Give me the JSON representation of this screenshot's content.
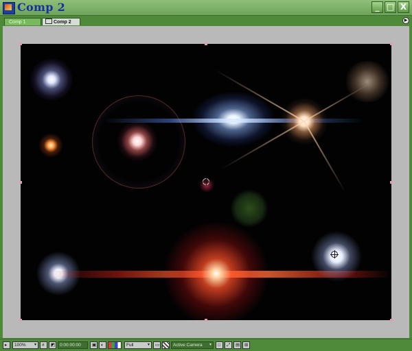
{
  "window": {
    "title": "Comp 2",
    "minimize_glyph": "_",
    "maximize_glyph": "□",
    "close_glyph": "X"
  },
  "tabs": [
    {
      "label": "Comp 1",
      "active": false
    },
    {
      "label": "Comp 2",
      "active": true
    }
  ],
  "panel_menu_glyph": "▶",
  "toolbar": {
    "zoom": "100%",
    "timecode": "0:00:00:00",
    "resolution": "Full",
    "camera": "Active Camera"
  },
  "colors": {
    "chrome_green": "#4e8a3a",
    "title_blue": "#1a2fa0",
    "pasteboard": "#b9b9b9",
    "canvas": "#020203"
  }
}
